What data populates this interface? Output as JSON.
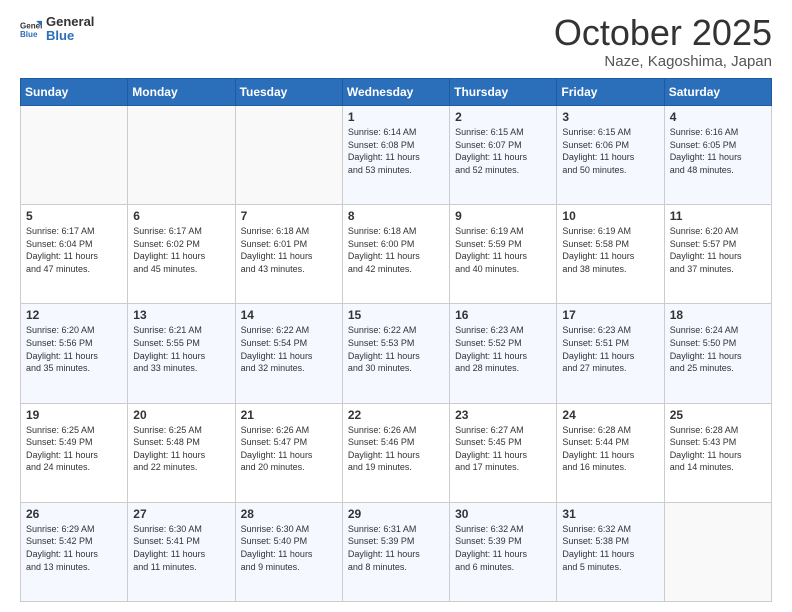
{
  "header": {
    "logo_line1": "General",
    "logo_line2": "Blue",
    "title": "October 2025",
    "subtitle": "Naze, Kagoshima, Japan"
  },
  "weekdays": [
    "Sunday",
    "Monday",
    "Tuesday",
    "Wednesday",
    "Thursday",
    "Friday",
    "Saturday"
  ],
  "weeks": [
    [
      {
        "day": "",
        "text": ""
      },
      {
        "day": "",
        "text": ""
      },
      {
        "day": "",
        "text": ""
      },
      {
        "day": "1",
        "text": "Sunrise: 6:14 AM\nSunset: 6:08 PM\nDaylight: 11 hours\nand 53 minutes."
      },
      {
        "day": "2",
        "text": "Sunrise: 6:15 AM\nSunset: 6:07 PM\nDaylight: 11 hours\nand 52 minutes."
      },
      {
        "day": "3",
        "text": "Sunrise: 6:15 AM\nSunset: 6:06 PM\nDaylight: 11 hours\nand 50 minutes."
      },
      {
        "day": "4",
        "text": "Sunrise: 6:16 AM\nSunset: 6:05 PM\nDaylight: 11 hours\nand 48 minutes."
      }
    ],
    [
      {
        "day": "5",
        "text": "Sunrise: 6:17 AM\nSunset: 6:04 PM\nDaylight: 11 hours\nand 47 minutes."
      },
      {
        "day": "6",
        "text": "Sunrise: 6:17 AM\nSunset: 6:02 PM\nDaylight: 11 hours\nand 45 minutes."
      },
      {
        "day": "7",
        "text": "Sunrise: 6:18 AM\nSunset: 6:01 PM\nDaylight: 11 hours\nand 43 minutes."
      },
      {
        "day": "8",
        "text": "Sunrise: 6:18 AM\nSunset: 6:00 PM\nDaylight: 11 hours\nand 42 minutes."
      },
      {
        "day": "9",
        "text": "Sunrise: 6:19 AM\nSunset: 5:59 PM\nDaylight: 11 hours\nand 40 minutes."
      },
      {
        "day": "10",
        "text": "Sunrise: 6:19 AM\nSunset: 5:58 PM\nDaylight: 11 hours\nand 38 minutes."
      },
      {
        "day": "11",
        "text": "Sunrise: 6:20 AM\nSunset: 5:57 PM\nDaylight: 11 hours\nand 37 minutes."
      }
    ],
    [
      {
        "day": "12",
        "text": "Sunrise: 6:20 AM\nSunset: 5:56 PM\nDaylight: 11 hours\nand 35 minutes."
      },
      {
        "day": "13",
        "text": "Sunrise: 6:21 AM\nSunset: 5:55 PM\nDaylight: 11 hours\nand 33 minutes."
      },
      {
        "day": "14",
        "text": "Sunrise: 6:22 AM\nSunset: 5:54 PM\nDaylight: 11 hours\nand 32 minutes."
      },
      {
        "day": "15",
        "text": "Sunrise: 6:22 AM\nSunset: 5:53 PM\nDaylight: 11 hours\nand 30 minutes."
      },
      {
        "day": "16",
        "text": "Sunrise: 6:23 AM\nSunset: 5:52 PM\nDaylight: 11 hours\nand 28 minutes."
      },
      {
        "day": "17",
        "text": "Sunrise: 6:23 AM\nSunset: 5:51 PM\nDaylight: 11 hours\nand 27 minutes."
      },
      {
        "day": "18",
        "text": "Sunrise: 6:24 AM\nSunset: 5:50 PM\nDaylight: 11 hours\nand 25 minutes."
      }
    ],
    [
      {
        "day": "19",
        "text": "Sunrise: 6:25 AM\nSunset: 5:49 PM\nDaylight: 11 hours\nand 24 minutes."
      },
      {
        "day": "20",
        "text": "Sunrise: 6:25 AM\nSunset: 5:48 PM\nDaylight: 11 hours\nand 22 minutes."
      },
      {
        "day": "21",
        "text": "Sunrise: 6:26 AM\nSunset: 5:47 PM\nDaylight: 11 hours\nand 20 minutes."
      },
      {
        "day": "22",
        "text": "Sunrise: 6:26 AM\nSunset: 5:46 PM\nDaylight: 11 hours\nand 19 minutes."
      },
      {
        "day": "23",
        "text": "Sunrise: 6:27 AM\nSunset: 5:45 PM\nDaylight: 11 hours\nand 17 minutes."
      },
      {
        "day": "24",
        "text": "Sunrise: 6:28 AM\nSunset: 5:44 PM\nDaylight: 11 hours\nand 16 minutes."
      },
      {
        "day": "25",
        "text": "Sunrise: 6:28 AM\nSunset: 5:43 PM\nDaylight: 11 hours\nand 14 minutes."
      }
    ],
    [
      {
        "day": "26",
        "text": "Sunrise: 6:29 AM\nSunset: 5:42 PM\nDaylight: 11 hours\nand 13 minutes."
      },
      {
        "day": "27",
        "text": "Sunrise: 6:30 AM\nSunset: 5:41 PM\nDaylight: 11 hours\nand 11 minutes."
      },
      {
        "day": "28",
        "text": "Sunrise: 6:30 AM\nSunset: 5:40 PM\nDaylight: 11 hours\nand 9 minutes."
      },
      {
        "day": "29",
        "text": "Sunrise: 6:31 AM\nSunset: 5:39 PM\nDaylight: 11 hours\nand 8 minutes."
      },
      {
        "day": "30",
        "text": "Sunrise: 6:32 AM\nSunset: 5:39 PM\nDaylight: 11 hours\nand 6 minutes."
      },
      {
        "day": "31",
        "text": "Sunrise: 6:32 AM\nSunset: 5:38 PM\nDaylight: 11 hours\nand 5 minutes."
      },
      {
        "day": "",
        "text": ""
      }
    ]
  ]
}
